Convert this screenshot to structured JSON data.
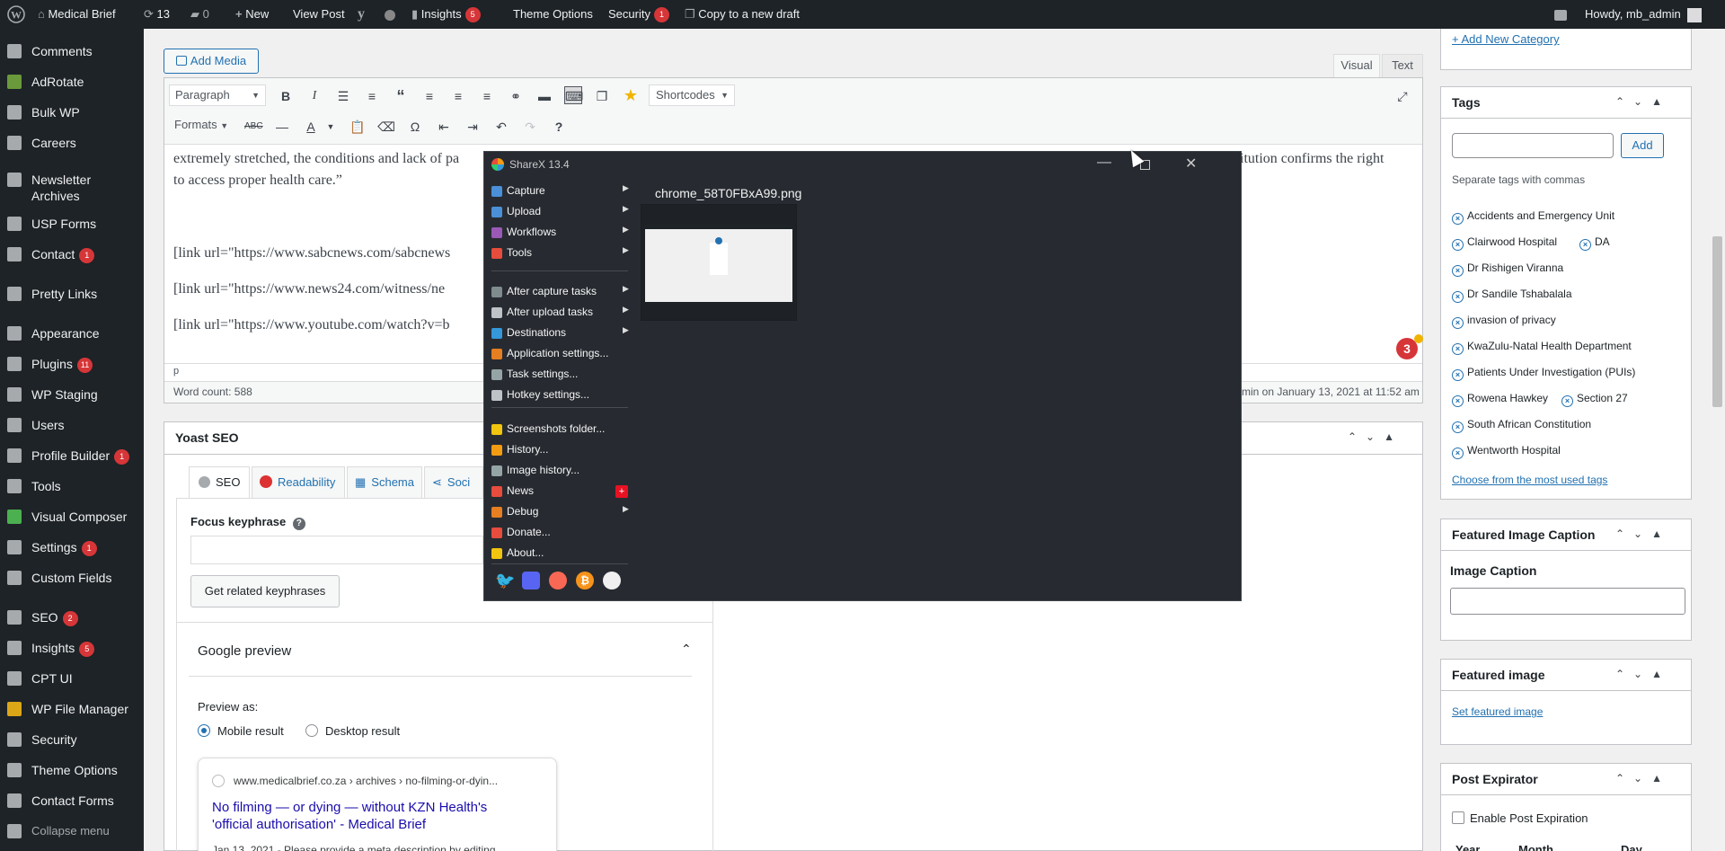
{
  "admin_bar": {
    "site_name": "Medical Brief",
    "updates_count": "13",
    "comments_count": "0",
    "new_label": "New",
    "view_post_label": "View Post",
    "insights_label": "Insights",
    "insights_badge": "5",
    "theme_options_label": "Theme Options",
    "security_label": "Security",
    "security_badge": "1",
    "copy_draft_label": "Copy to a new draft",
    "howdy": "Howdy, mb_admin"
  },
  "sidebar": {
    "items": [
      {
        "label": "Comments",
        "badge": "",
        "icon": "comment-icon",
        "color": "#a7aaad"
      },
      {
        "label": "AdRotate",
        "badge": "",
        "icon": "adrotate-icon",
        "color": "#6a9a3b"
      },
      {
        "label": "Bulk WP",
        "badge": "",
        "icon": "bulk-icon",
        "color": "#a7aaad"
      },
      {
        "label": "Careers",
        "badge": "",
        "icon": "pin-icon",
        "color": "#a7aaad"
      },
      {
        "label": "Newsletter",
        "label2": "Archives",
        "badge": "",
        "icon": "pin-icon",
        "color": "#a7aaad"
      },
      {
        "label": "USP Forms",
        "badge": "",
        "icon": "form-icon",
        "color": "#a7aaad"
      },
      {
        "label": "Contact",
        "badge": "1",
        "icon": "mail-icon",
        "color": "#a7aaad"
      },
      {
        "label": "Pretty Links",
        "badge": "",
        "icon": "link-icon",
        "color": "#a7aaad"
      },
      {
        "label": "Appearance",
        "badge": "",
        "icon": "brush-icon",
        "color": "#a7aaad"
      },
      {
        "label": "Plugins",
        "badge": "11",
        "icon": "plugin-icon",
        "color": "#a7aaad"
      },
      {
        "label": "WP Staging",
        "badge": "",
        "icon": "staging-icon",
        "color": "#a7aaad"
      },
      {
        "label": "Users",
        "badge": "",
        "icon": "users-icon",
        "color": "#a7aaad"
      },
      {
        "label": "Profile Builder",
        "badge": "1",
        "icon": "profile-icon",
        "color": "#a7aaad"
      },
      {
        "label": "Tools",
        "badge": "",
        "icon": "wrench-icon",
        "color": "#a7aaad"
      },
      {
        "label": "Visual Composer",
        "badge": "",
        "icon": "vc-icon",
        "color": "#4caf50"
      },
      {
        "label": "Settings",
        "badge": "1",
        "icon": "settings-icon",
        "color": "#a7aaad"
      },
      {
        "label": "Custom Fields",
        "badge": "",
        "icon": "fields-icon",
        "color": "#a7aaad"
      },
      {
        "label": "SEO",
        "badge": "2",
        "icon": "yoast-icon",
        "color": "#a7aaad"
      },
      {
        "label": "Insights",
        "badge": "5",
        "icon": "insights-icon",
        "color": "#a7aaad"
      },
      {
        "label": "CPT UI",
        "badge": "",
        "icon": "cpt-icon",
        "color": "#a7aaad"
      },
      {
        "label": "WP File Manager",
        "badge": "",
        "icon": "folder-icon",
        "color": "#dba617"
      },
      {
        "label": "Security",
        "badge": "",
        "icon": "shield-icon",
        "color": "#a7aaad"
      },
      {
        "label": "Theme Options",
        "badge": "",
        "icon": "gear-icon",
        "color": "#a7aaad"
      },
      {
        "label": "Contact Forms",
        "badge": "",
        "icon": "list-icon",
        "color": "#a7aaad"
      },
      {
        "label": "Collapse menu",
        "badge": "",
        "icon": "collapse-icon",
        "color": "#a7aaad"
      }
    ]
  },
  "editor": {
    "add_media_label": "Add Media",
    "visual_tab": "Visual",
    "text_tab": "Text",
    "paragraph_select": "Paragraph",
    "formats_label": "Formats",
    "shortcodes_label": "Shortcodes",
    "body_line1": "extremely stretched, the conditions and lack of pa",
    "body_line1_right": "itution confirms the right",
    "body_line2": "to access proper health care.”",
    "link1": "[link url=\"https://www.sabcnews.com/sabcnews",
    "link2": "[link url=\"https://www.news24.com/witness/ne",
    "link3": "[link url=\"https://www.youtube.com/watch?v=b",
    "path": "p",
    "word_count": "Word count: 588",
    "last_edited": "min on January 13, 2021 at 11:52 am",
    "notification_badge": "3"
  },
  "yoast": {
    "title": "Yoast SEO",
    "tabs": [
      "SEO",
      "Readability",
      "Schema",
      "Soci"
    ],
    "focus_label": "Focus keyphrase",
    "related_button": "Get related keyphrases",
    "google_preview": "Google preview",
    "preview_as": "Preview as:",
    "mobile_result": "Mobile result",
    "desktop_result": "Desktop result",
    "snippet_url": "www.medicalbrief.co.za › archives › no-filming-or-dyin...",
    "snippet_title": "No filming — or dying — without KZN Health's 'official authorisation' - Medical Brief",
    "snippet_desc": "Jan 13, 2021 - Please provide a meta description by editing"
  },
  "right": {
    "add_category": "+ Add New Category",
    "tags_title": "Tags",
    "tags_add": "Add",
    "tags_hint": "Separate tags with commas",
    "tags": [
      "Accidents and Emergency Unit",
      "Clairwood Hospital",
      "DA",
      "Dr Rishigen Viranna",
      "Dr Sandile Tshabalala",
      "invasion of privacy",
      "KwaZulu-Natal Health Department",
      "Patients Under Investigation (PUIs)",
      "Rowena Hawkey",
      "Section 27",
      "South African Constitution",
      "Wentworth Hospital"
    ],
    "most_used": "Choose from the most used tags",
    "caption_title": "Featured Image Caption",
    "caption_label": "Image Caption",
    "featured_title": "Featured image",
    "set_featured": "Set featured image",
    "expirator_title": "Post Expirator",
    "enable_expiration": "Enable Post Expiration",
    "year_label": "Year",
    "month_label": "Month",
    "day_label": "Day"
  },
  "sharex": {
    "title": "ShareX 13.4",
    "file_name": "chrome_58T0FBxA99.png",
    "menu": [
      {
        "label": "Capture",
        "arrow": true,
        "icon": "capture-icon",
        "color": "#4a90d9"
      },
      {
        "label": "Upload",
        "arrow": true,
        "icon": "upload-icon",
        "color": "#4a90d9"
      },
      {
        "label": "Workflows",
        "arrow": true,
        "icon": "workflows-icon",
        "color": "#9b59b6"
      },
      {
        "label": "Tools",
        "arrow": true,
        "icon": "tools-icon",
        "color": "#e74c3c"
      },
      {
        "label": "After capture tasks",
        "arrow": true,
        "icon": "after-capture-icon",
        "color": "#7f8c8d"
      },
      {
        "label": "After upload tasks",
        "arrow": true,
        "icon": "after-upload-icon",
        "color": "#bdc3c7"
      },
      {
        "label": "Destinations",
        "arrow": true,
        "icon": "destinations-icon",
        "color": "#3498db"
      },
      {
        "label": "Application settings...",
        "arrow": false,
        "icon": "app-settings-icon",
        "color": "#e67e22"
      },
      {
        "label": "Task settings...",
        "arrow": false,
        "icon": "task-settings-icon",
        "color": "#95a5a6"
      },
      {
        "label": "Hotkey settings...",
        "arrow": false,
        "icon": "hotkey-icon",
        "color": "#bdc3c7"
      },
      {
        "label": "Screenshots folder...",
        "arrow": false,
        "icon": "folder-icon",
        "color": "#f1c40f"
      },
      {
        "label": "History...",
        "arrow": false,
        "icon": "history-icon",
        "color": "#f39c12"
      },
      {
        "label": "Image history...",
        "arrow": false,
        "icon": "image-history-icon",
        "color": "#95a5a6"
      },
      {
        "label": "News",
        "arrow": false,
        "icon": "news-icon",
        "color": "#e74c3c"
      },
      {
        "label": "Debug",
        "arrow": true,
        "icon": "debug-icon",
        "color": "#e67e22"
      },
      {
        "label": "Donate...",
        "arrow": false,
        "icon": "heart-icon",
        "color": "#e74c3c"
      },
      {
        "label": "About...",
        "arrow": false,
        "icon": "crown-icon",
        "color": "#f1c40f"
      }
    ],
    "news_badge": "+"
  }
}
